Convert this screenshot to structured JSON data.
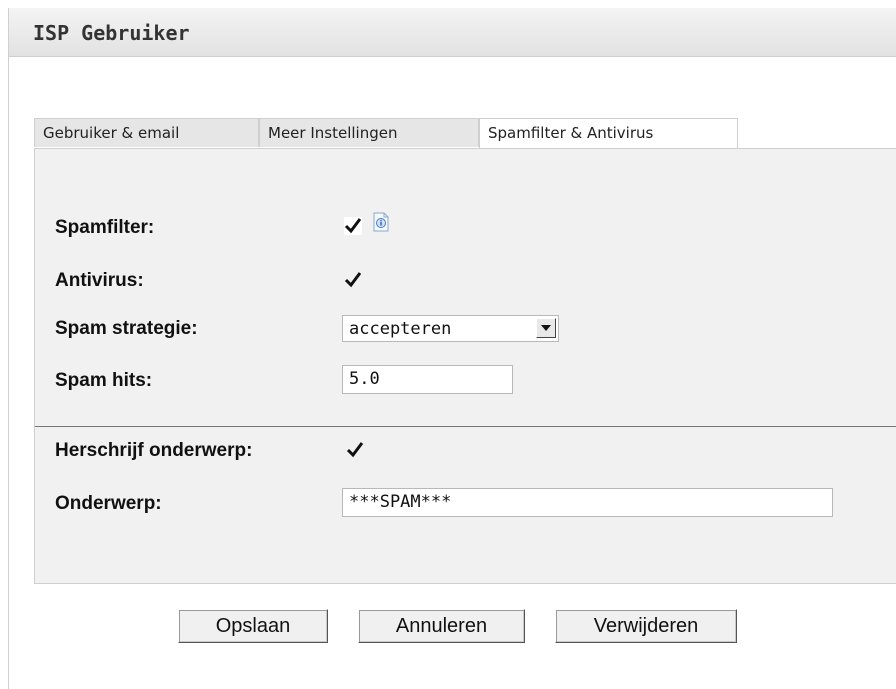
{
  "header": {
    "title": "ISP Gebruiker"
  },
  "tabs": [
    {
      "label": "Gebruiker & email",
      "active": false
    },
    {
      "label": "Meer Instellingen",
      "active": false
    },
    {
      "label": "Spamfilter & Antivirus",
      "active": true
    }
  ],
  "form": {
    "spamfilter_label": "Spamfilter:",
    "spamfilter_checked": true,
    "antivirus_label": "Antivirus:",
    "antivirus_checked": true,
    "strategy_label": "Spam strategie:",
    "strategy_value": "accepteren",
    "hits_label": "Spam hits:",
    "hits_value": "5.0",
    "rewrite_label": "Herschrijf onderwerp:",
    "rewrite_checked": true,
    "subject_label": "Onderwerp:",
    "subject_value": "***SPAM***"
  },
  "buttons": {
    "save": "Opslaan",
    "cancel": "Annuleren",
    "delete": "Verwijderen"
  },
  "icons": {
    "checkbox": "checkmark-icon",
    "info": "info-icon",
    "dropdown": "triangle-down-icon"
  }
}
